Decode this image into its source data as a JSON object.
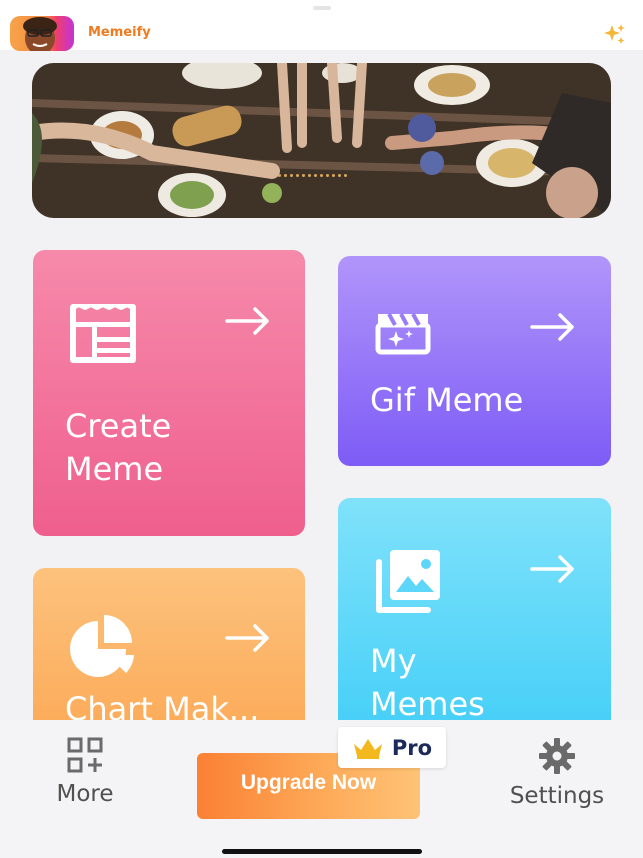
{
  "header": {
    "app_title": "Memeify"
  },
  "cards": {
    "create_meme": "Create\nMeme",
    "gif_meme": "Gif Meme",
    "chart_maker": "Chart Mak...",
    "my_memes": "My\nMemes"
  },
  "nav": {
    "more": "More",
    "settings": "Settings"
  },
  "upgrade": {
    "label": "Upgrade Now",
    "badge": "Pro"
  },
  "colors": {
    "accent": "#f07b1f",
    "create": "#ef5f8e",
    "gif": "#7d5cf6",
    "chart": "#fba651",
    "my_memes": "#3fcdf8"
  },
  "icons": [
    "sparkle-icon",
    "meme-template-icon",
    "arrow-right-icon",
    "clapper-sparkle-icon",
    "pie-chart-icon",
    "photo-gallery-icon",
    "grid-plus-icon",
    "gear-icon",
    "crown-icon"
  ]
}
